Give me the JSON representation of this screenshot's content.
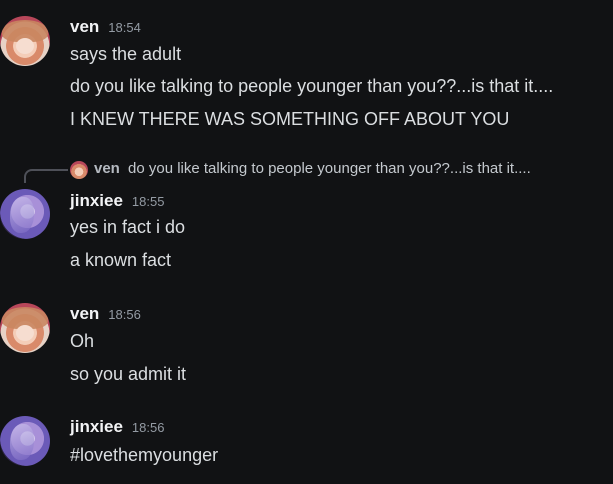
{
  "messages": [
    {
      "author": "ven",
      "time": "18:54",
      "avatar": "ven-avatar",
      "lines": [
        "says the adult",
        "do you like talking to people younger than you??...is that it....",
        "I KNEW THERE WAS SOMETHING OFF ABOUT YOU"
      ]
    },
    {
      "author": "jinxiee",
      "time": "18:55",
      "avatar": "jinxiee-avatar",
      "reply": {
        "author": "ven",
        "text": "do you like talking to people younger than you??...is that it...."
      },
      "lines": [
        "yes in fact i do",
        "a known fact"
      ]
    },
    {
      "author": "ven",
      "time": "18:56",
      "avatar": "ven-avatar",
      "lines": [
        "Oh",
        "so you admit it"
      ]
    },
    {
      "author": "jinxiee",
      "time": "18:56",
      "avatar": "jinxiee-avatar",
      "lines": [
        "#lovethemyounger"
      ]
    }
  ],
  "colors": {
    "background": "#111214",
    "username": "#f2f3f5",
    "timestamp": "#949ba4",
    "message_text": "#dbdee1",
    "reply_spine": "#4e5058"
  }
}
